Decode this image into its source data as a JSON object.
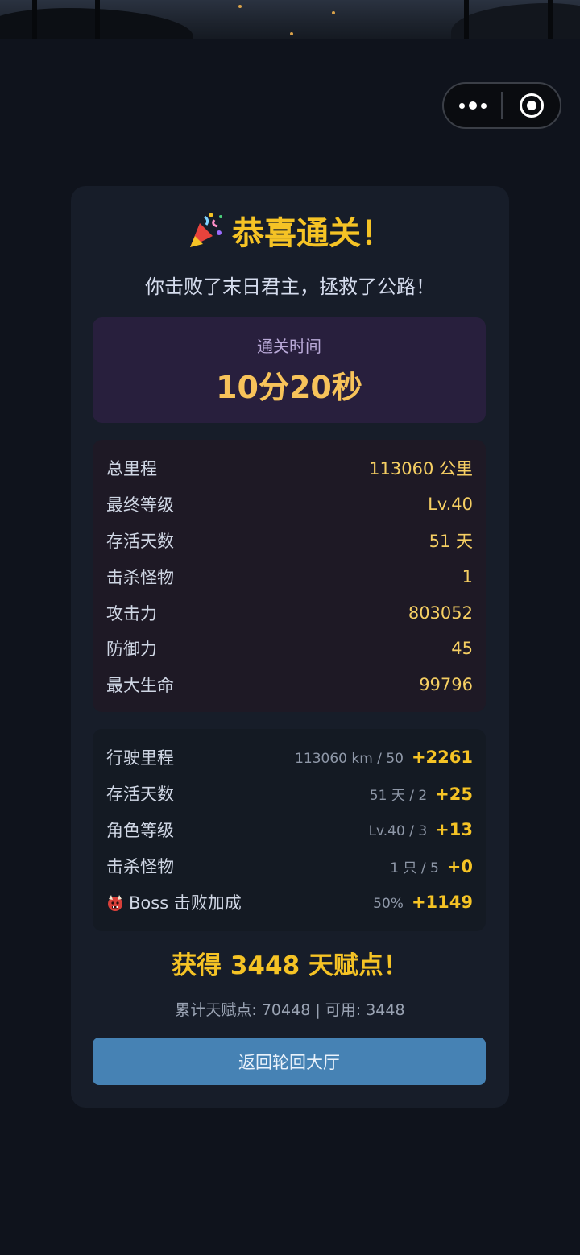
{
  "header_capsule": {
    "more_icon": "more-dots-icon",
    "close_icon": "target-icon"
  },
  "result": {
    "title": "恭喜通关！",
    "title_icon": "party-popper-icon",
    "subtitle": "你击败了末日君主，拯救了公路！",
    "time_label": "通关时间",
    "time_value": "10分20秒"
  },
  "stats": [
    {
      "label": "总里程",
      "value": "113060 公里"
    },
    {
      "label": "最终等级",
      "value": "Lv.40"
    },
    {
      "label": "存活天数",
      "value": "51 天"
    },
    {
      "label": "击杀怪物",
      "value": "1"
    },
    {
      "label": "攻击力",
      "value": "803052"
    },
    {
      "label": "防御力",
      "value": "45"
    },
    {
      "label": "最大生命",
      "value": "99796"
    }
  ],
  "rewards": [
    {
      "label": "行驶里程",
      "calc": "113060 km / 50",
      "bonus": "+2261"
    },
    {
      "label": "存活天数",
      "calc": "51 天 / 2",
      "bonus": "+25"
    },
    {
      "label": "角色等级",
      "calc": "Lv.40 / 3",
      "bonus": "+13"
    },
    {
      "label": "击杀怪物",
      "calc": "1 只 / 5",
      "bonus": "+0"
    },
    {
      "label": "Boss 击败加成",
      "calc": "50%",
      "bonus": "+1149",
      "icon": "ogre-icon"
    }
  ],
  "gain_text": "获得 3448 天赋点！",
  "accumulated_text": "累计天赋点: 70448 | 可用: 3448",
  "return_button": "返回轮回大厅",
  "colors": {
    "accent": "#f5c325",
    "button": "#4682b4",
    "card": "#171d29"
  }
}
